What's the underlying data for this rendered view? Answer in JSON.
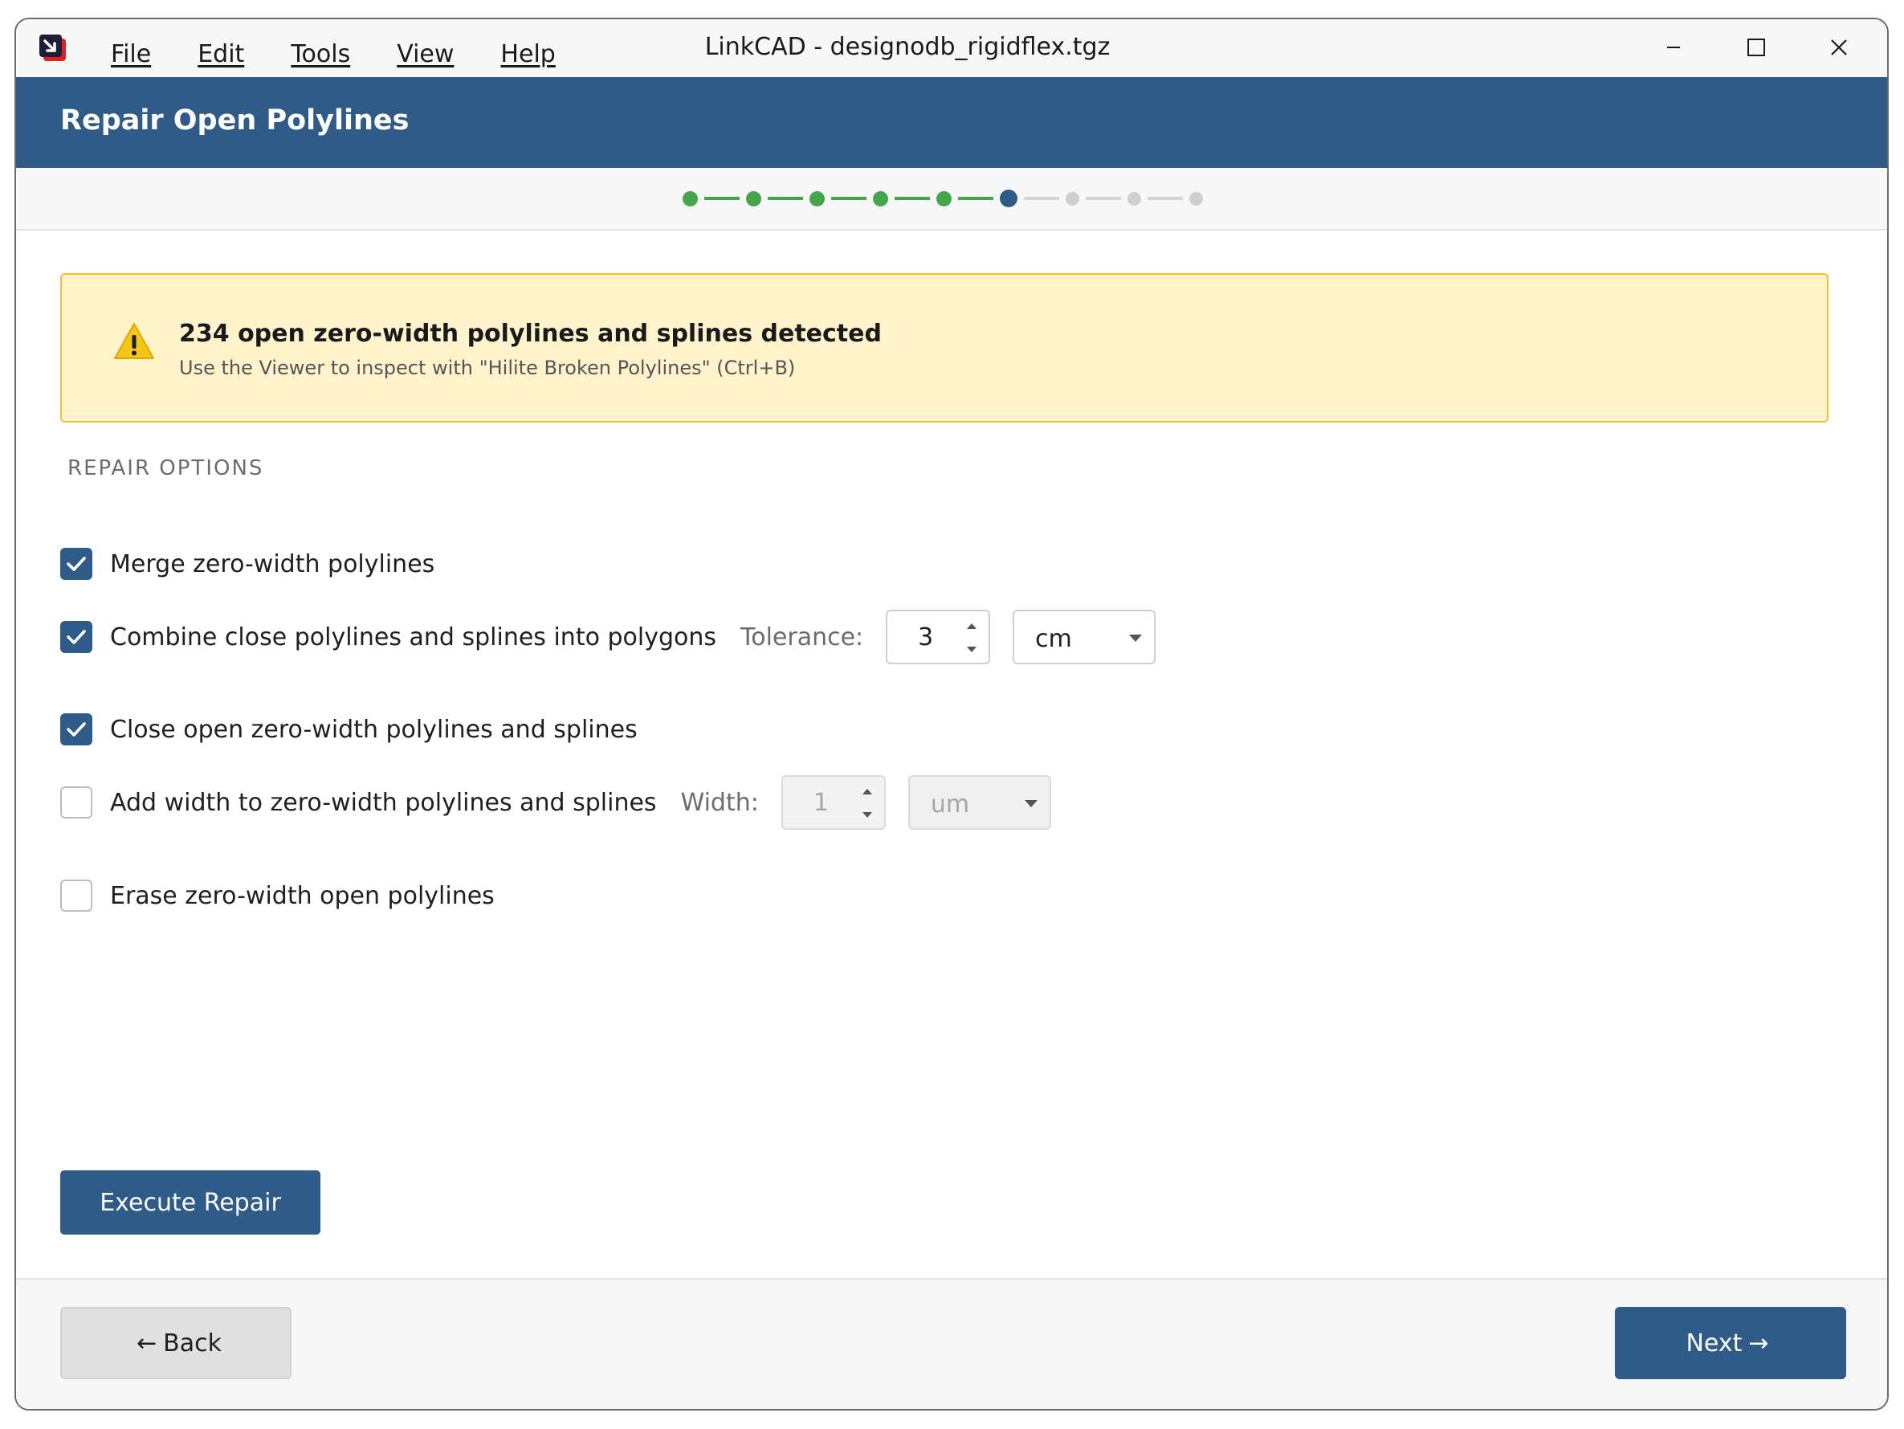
{
  "app": {
    "window_title": "LinkCAD - designodb_rigidflex.tgz",
    "menu": [
      {
        "label": "File"
      },
      {
        "label": "Edit"
      },
      {
        "label": "Tools"
      },
      {
        "label": "View"
      },
      {
        "label": "Help"
      }
    ]
  },
  "header": {
    "title": "Repair Open Polylines"
  },
  "stepper": {
    "total_steps": 9,
    "current_step": 6,
    "completed_steps": 5,
    "colors": {
      "done": "#43a64a",
      "current": "#2e5b87",
      "todo": "#cfcfcf"
    }
  },
  "warning": {
    "title": "234 open zero-width polylines and splines detected",
    "subtitle": "Use the Viewer to inspect with \"Hilite Broken Polylines\" (Ctrl+B)",
    "icon": "warning-triangle-icon"
  },
  "repair_options": {
    "section_label": "REPAIR OPTIONS",
    "merge": {
      "label": "Merge zero-width polylines",
      "checked": true
    },
    "combine": {
      "label": "Combine close polylines and splines into polygons",
      "checked": true,
      "tolerance_label": "Tolerance:",
      "tolerance_value": "3",
      "unit": "cm"
    },
    "close": {
      "label": "Close open zero-width polylines and splines",
      "checked": true
    },
    "add_width": {
      "label": "Add width to zero-width polylines and splines",
      "checked": false,
      "width_label": "Width:",
      "width_value": "1",
      "unit": "um"
    },
    "erase": {
      "label": "Erase zero-width open polylines",
      "checked": false
    }
  },
  "buttons": {
    "execute": "Execute Repair",
    "back": "Back",
    "next": "Next"
  },
  "colors": {
    "brand": "#2e5b87",
    "warning_bg": "#fff3cc",
    "warning_border": "#f0c232",
    "success": "#43a64a"
  }
}
